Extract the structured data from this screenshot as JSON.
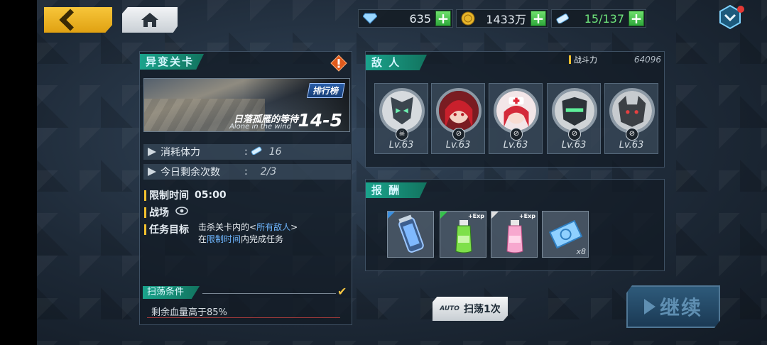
{
  "topbar": {
    "back_icon": "back-chevron-icon",
    "home_icon": "home-icon",
    "gems": "635",
    "gold": "1433万",
    "stamina": "15/137",
    "plus": "+"
  },
  "stage": {
    "tab_title": "异变关卡",
    "rank_label": "排行榜",
    "name": "日落孤雁的等待",
    "subtitle": "Alone in the wind",
    "number": "14-5",
    "cost_label": "消耗体力",
    "cost_sep": ":",
    "cost_value": "16",
    "attempts_label": "今日剩余次数",
    "attempts_sep": ":",
    "attempts_value": "2/3",
    "time_label": "限制时间",
    "time_value": "05:00",
    "field_label": "战场",
    "goal_label": "任务目标",
    "goal_line1_pre": "击杀关卡内的<",
    "goal_line1_hl": "所有敌人",
    "goal_line1_post": ">",
    "goal_line2_pre": "在",
    "goal_line2_hl": "限制时间",
    "goal_line2_post": "内完成任务",
    "sweep_title": "扫荡条件",
    "sweep_condition": "剩余血量高于85%"
  },
  "enemies": {
    "tab_title": "敌 人",
    "power_label": "战斗力",
    "power_value": "64096",
    "list": [
      {
        "level": "Lv.63"
      },
      {
        "level": "Lv.63"
      },
      {
        "level": "Lv.63"
      },
      {
        "level": "Lv.63"
      },
      {
        "level": "Lv.63"
      }
    ]
  },
  "rewards": {
    "tab_title": "报 酬",
    "items": [
      {
        "icon": "canister-icon",
        "rarity_color": "#3a8fe0",
        "exp": "",
        "count": ""
      },
      {
        "icon": "green-bottle-icon",
        "rarity_color": "#35c24a",
        "exp": "+Exp",
        "count": ""
      },
      {
        "icon": "pink-bottle-icon",
        "rarity_color": "#e0e0e0",
        "exp": "+Exp",
        "count": ""
      },
      {
        "icon": "blue-ticket-icon",
        "rarity_color": "",
        "exp": "",
        "count": "x8"
      }
    ]
  },
  "actions": {
    "auto_label": "AUTO",
    "sweep_label": "扫荡1次",
    "continue_label": "继续"
  },
  "colors": {
    "accent_teal": "#1aa38c",
    "gold": "#f2c12e",
    "highlight_blue": "#6fb6ff"
  }
}
